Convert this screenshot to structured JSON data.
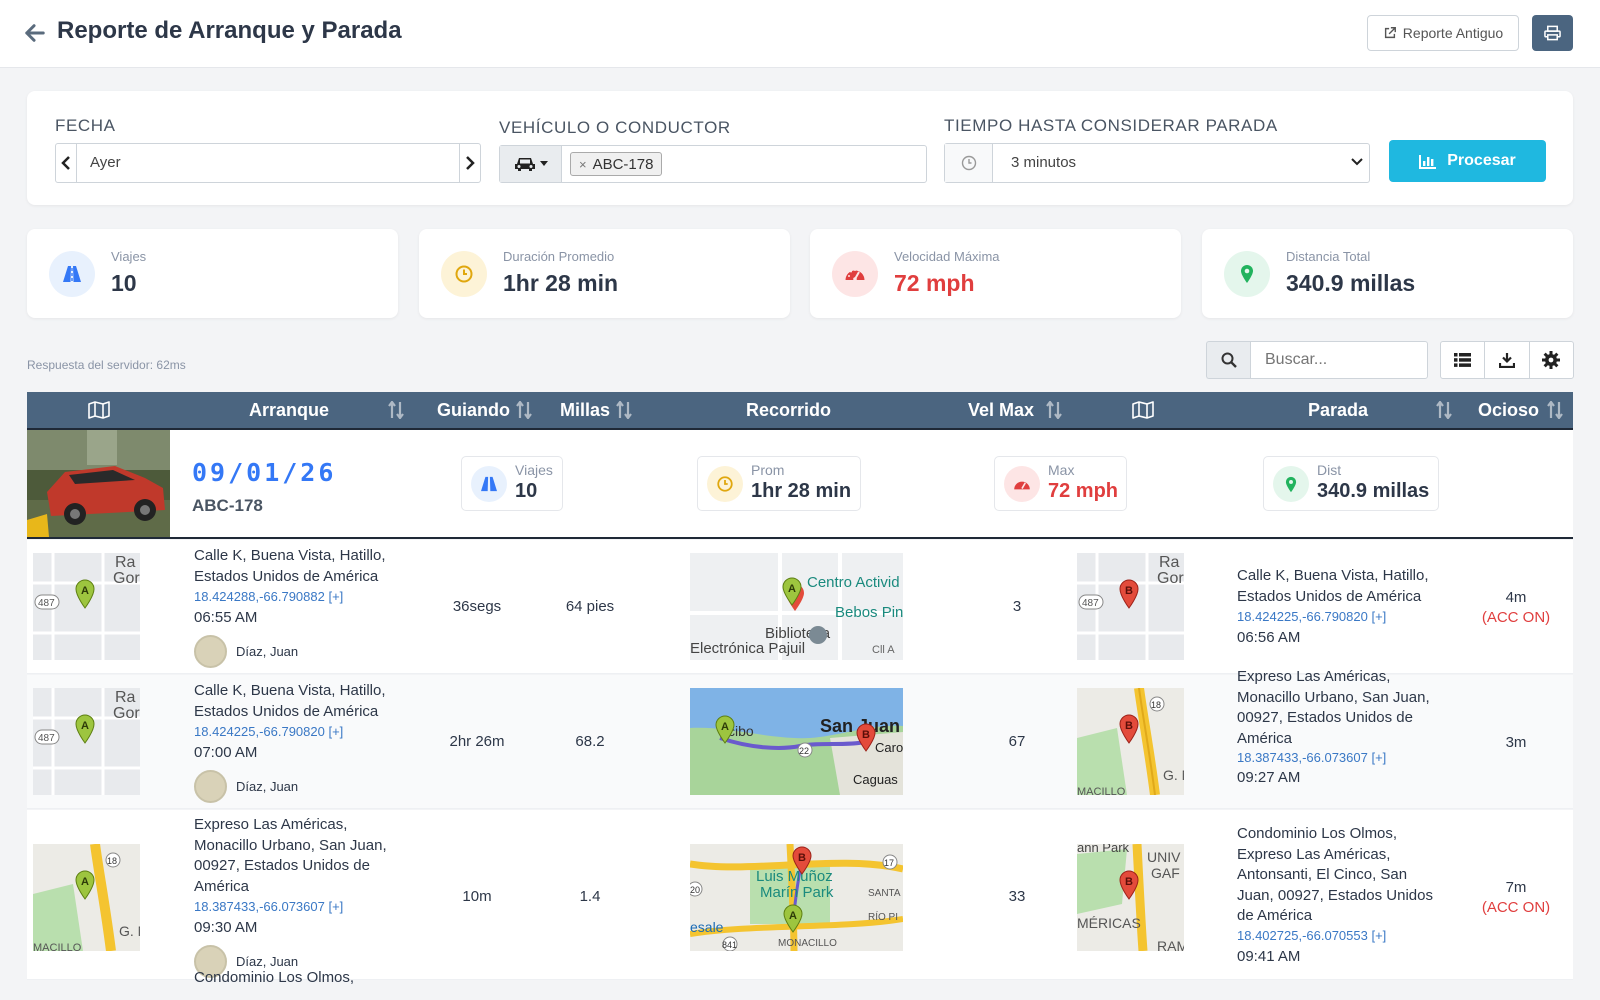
{
  "header": {
    "title": "Reporte de Arranque y Parada",
    "old_report_label": "Reporte Antiguo"
  },
  "filters": {
    "date_label": "FECHA",
    "date_value": "Ayer",
    "vehicle_label": "VEHÍCULO O CONDUCTOR",
    "vehicle_tag": "ABC-178",
    "stop_time_label": "TIEMPO HASTA CONSIDERAR PARADA",
    "stop_time_value": "3 minutos",
    "process_label": "Procesar"
  },
  "stats": [
    {
      "label": "Viajes",
      "value": "10"
    },
    {
      "label": "Duración Promedio",
      "value": "1hr 28 min"
    },
    {
      "label": "Velocidad Máxima",
      "value": "72 mph"
    },
    {
      "label": "Distancia Total",
      "value": "340.9 millas"
    }
  ],
  "server_response": "Respuesta del servidor: 62ms",
  "search": {
    "placeholder": "Buscar..."
  },
  "table": {
    "columns": {
      "start": "Arranque",
      "driving": "Guiando",
      "miles": "Millas",
      "route": "Recorrido",
      "max_speed": "Vel Max",
      "stop": "Parada",
      "idle": "Ocioso"
    },
    "group": {
      "date": "09/01/26",
      "plate": "ABC-178",
      "trips_label": "Viajes",
      "trips_value": "10",
      "avg_label": "Prom",
      "avg_value": "1hr 28 min",
      "max_label": "Max",
      "max_value": "72 mph",
      "dist_label": "Dist",
      "dist_value": "340.9 millas"
    },
    "rows": [
      {
        "start_addr": "Calle K, Buena Vista, Hatillo, Estados Unidos de América",
        "start_coord": "18.424288,-66.790882 [+]",
        "start_time": "06:55 AM",
        "driver": "Díaz, Juan",
        "driving": "36segs",
        "miles": "64 pies",
        "max_speed": "3",
        "stop_addr": "Calle K, Buena Vista, Hatillo, Estados Unidos de América",
        "stop_coord": "18.424225,-66.790820 [+]",
        "stop_time": "06:56 AM",
        "idle": "4m",
        "idle_acc": "(ACC ON)",
        "route_map_labels": [
          "Centro Activid",
          "Bebos Pin",
          "Biblioteca",
          "Electrónica Pajuil",
          "Cll A"
        ]
      },
      {
        "start_addr": "Calle K, Buena Vista, Hatillo, Estados Unidos de América",
        "start_coord": "18.424225,-66.790820 [+]",
        "start_time": "07:00 AM",
        "driver": "Díaz, Juan",
        "driving": "2hr 26m",
        "miles": "68.2",
        "max_speed": "67",
        "stop_addr": "Expreso Las Américas, Monacillo Urbano, San Juan, 00927, Estados Unidos de América",
        "stop_coord": "18.387433,-66.073607 [+]",
        "stop_time": "09:27 AM",
        "idle": "3m",
        "idle_acc": "",
        "route_map_labels": [
          "cibo",
          "San Juan",
          "Caroli",
          "Caguas"
        ]
      },
      {
        "start_addr": "Expreso Las Américas, Monacillo Urbano, San Juan, 00927, Estados Unidos de América",
        "start_coord": "18.387433,-66.073607 [+]",
        "start_time": "09:30 AM",
        "driver": "Díaz, Juan",
        "driving": "10m",
        "miles": "1.4",
        "max_speed": "33",
        "stop_addr": "Condominio Los Olmos, Expreso Las Américas, Antonsanti, El Cinco, San Juan, 00927, Estados Unidos de América",
        "stop_coord": "18.402725,-66.070553 [+]",
        "stop_time": "09:41 AM",
        "idle": "7m",
        "idle_acc": "(ACC ON)",
        "route_map_labels": [
          "Luis Muñoz",
          "Marín Park",
          "SANTA",
          "RÍO PI",
          "esale",
          "MONACILLO"
        ]
      }
    ],
    "next_row_addr": "Condominio Los Olmos,"
  },
  "map_labels": {
    "gor": "Gor",
    "ra": "Ra",
    "r487": "487",
    "r18": "18",
    "gn": "G. N",
    "macillo": "MACILLO",
    "park": "ann Park",
    "univ": "UNIV",
    "gar": "GAF",
    "mericas": "MÉRICAS",
    "ram": "RAM",
    "pin_a": "A",
    "pin_b": "B",
    "r22": "22",
    "r17": "17",
    "r841": "841",
    "r20": "20"
  },
  "colors": {
    "header_bg": "#4b6580",
    "accent": "#1fb8e0",
    "danger": "#e03e3e",
    "link": "#3a78c5"
  }
}
